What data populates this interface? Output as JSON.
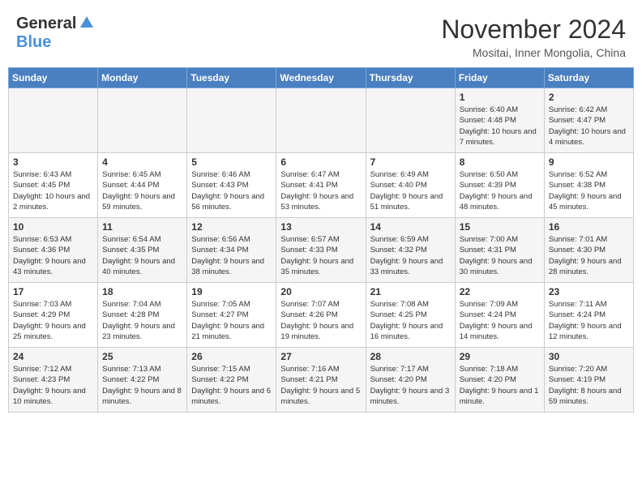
{
  "header": {
    "logo_general": "General",
    "logo_blue": "Blue",
    "month": "November 2024",
    "location": "Mositai, Inner Mongolia, China"
  },
  "days_of_week": [
    "Sunday",
    "Monday",
    "Tuesday",
    "Wednesday",
    "Thursday",
    "Friday",
    "Saturday"
  ],
  "weeks": [
    [
      {
        "day": "",
        "info": ""
      },
      {
        "day": "",
        "info": ""
      },
      {
        "day": "",
        "info": ""
      },
      {
        "day": "",
        "info": ""
      },
      {
        "day": "",
        "info": ""
      },
      {
        "day": "1",
        "info": "Sunrise: 6:40 AM\nSunset: 4:48 PM\nDaylight: 10 hours and 7 minutes."
      },
      {
        "day": "2",
        "info": "Sunrise: 6:42 AM\nSunset: 4:47 PM\nDaylight: 10 hours and 4 minutes."
      }
    ],
    [
      {
        "day": "3",
        "info": "Sunrise: 6:43 AM\nSunset: 4:45 PM\nDaylight: 10 hours and 2 minutes."
      },
      {
        "day": "4",
        "info": "Sunrise: 6:45 AM\nSunset: 4:44 PM\nDaylight: 9 hours and 59 minutes."
      },
      {
        "day": "5",
        "info": "Sunrise: 6:46 AM\nSunset: 4:43 PM\nDaylight: 9 hours and 56 minutes."
      },
      {
        "day": "6",
        "info": "Sunrise: 6:47 AM\nSunset: 4:41 PM\nDaylight: 9 hours and 53 minutes."
      },
      {
        "day": "7",
        "info": "Sunrise: 6:49 AM\nSunset: 4:40 PM\nDaylight: 9 hours and 51 minutes."
      },
      {
        "day": "8",
        "info": "Sunrise: 6:50 AM\nSunset: 4:39 PM\nDaylight: 9 hours and 48 minutes."
      },
      {
        "day": "9",
        "info": "Sunrise: 6:52 AM\nSunset: 4:38 PM\nDaylight: 9 hours and 45 minutes."
      }
    ],
    [
      {
        "day": "10",
        "info": "Sunrise: 6:53 AM\nSunset: 4:36 PM\nDaylight: 9 hours and 43 minutes."
      },
      {
        "day": "11",
        "info": "Sunrise: 6:54 AM\nSunset: 4:35 PM\nDaylight: 9 hours and 40 minutes."
      },
      {
        "day": "12",
        "info": "Sunrise: 6:56 AM\nSunset: 4:34 PM\nDaylight: 9 hours and 38 minutes."
      },
      {
        "day": "13",
        "info": "Sunrise: 6:57 AM\nSunset: 4:33 PM\nDaylight: 9 hours and 35 minutes."
      },
      {
        "day": "14",
        "info": "Sunrise: 6:59 AM\nSunset: 4:32 PM\nDaylight: 9 hours and 33 minutes."
      },
      {
        "day": "15",
        "info": "Sunrise: 7:00 AM\nSunset: 4:31 PM\nDaylight: 9 hours and 30 minutes."
      },
      {
        "day": "16",
        "info": "Sunrise: 7:01 AM\nSunset: 4:30 PM\nDaylight: 9 hours and 28 minutes."
      }
    ],
    [
      {
        "day": "17",
        "info": "Sunrise: 7:03 AM\nSunset: 4:29 PM\nDaylight: 9 hours and 25 minutes."
      },
      {
        "day": "18",
        "info": "Sunrise: 7:04 AM\nSunset: 4:28 PM\nDaylight: 9 hours and 23 minutes."
      },
      {
        "day": "19",
        "info": "Sunrise: 7:05 AM\nSunset: 4:27 PM\nDaylight: 9 hours and 21 minutes."
      },
      {
        "day": "20",
        "info": "Sunrise: 7:07 AM\nSunset: 4:26 PM\nDaylight: 9 hours and 19 minutes."
      },
      {
        "day": "21",
        "info": "Sunrise: 7:08 AM\nSunset: 4:25 PM\nDaylight: 9 hours and 16 minutes."
      },
      {
        "day": "22",
        "info": "Sunrise: 7:09 AM\nSunset: 4:24 PM\nDaylight: 9 hours and 14 minutes."
      },
      {
        "day": "23",
        "info": "Sunrise: 7:11 AM\nSunset: 4:24 PM\nDaylight: 9 hours and 12 minutes."
      }
    ],
    [
      {
        "day": "24",
        "info": "Sunrise: 7:12 AM\nSunset: 4:23 PM\nDaylight: 9 hours and 10 minutes."
      },
      {
        "day": "25",
        "info": "Sunrise: 7:13 AM\nSunset: 4:22 PM\nDaylight: 9 hours and 8 minutes."
      },
      {
        "day": "26",
        "info": "Sunrise: 7:15 AM\nSunset: 4:22 PM\nDaylight: 9 hours and 6 minutes."
      },
      {
        "day": "27",
        "info": "Sunrise: 7:16 AM\nSunset: 4:21 PM\nDaylight: 9 hours and 5 minutes."
      },
      {
        "day": "28",
        "info": "Sunrise: 7:17 AM\nSunset: 4:20 PM\nDaylight: 9 hours and 3 minutes."
      },
      {
        "day": "29",
        "info": "Sunrise: 7:18 AM\nSunset: 4:20 PM\nDaylight: 9 hours and 1 minute."
      },
      {
        "day": "30",
        "info": "Sunrise: 7:20 AM\nSunset: 4:19 PM\nDaylight: 8 hours and 59 minutes."
      }
    ]
  ]
}
